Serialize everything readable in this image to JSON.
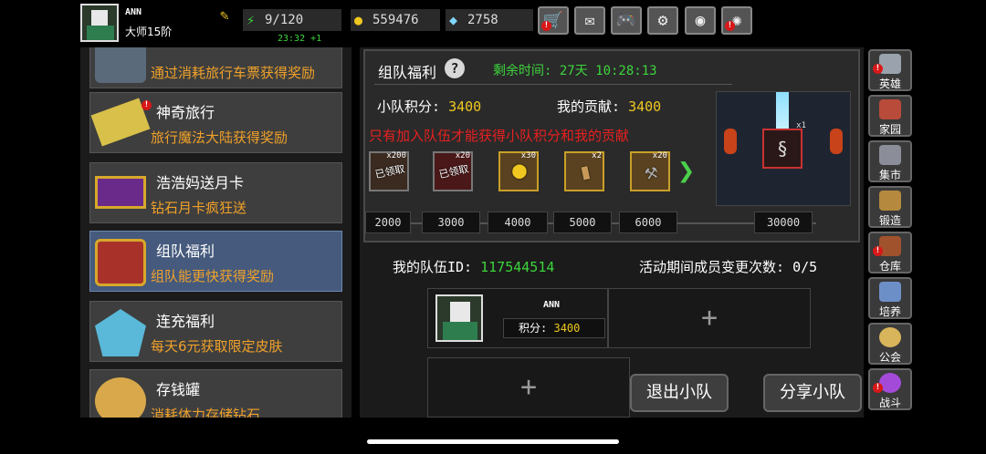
{
  "player": {
    "name": "ANN",
    "rank": "大师15阶"
  },
  "stats": {
    "energy": "9/120",
    "energy_timer": "23:32 +1",
    "gold": "559476",
    "gems": "2758"
  },
  "top_buttons": [
    {
      "name": "shop-cart-button",
      "glyph": "🛒",
      "alert": true
    },
    {
      "name": "mail-button",
      "glyph": "✉",
      "alert": false
    },
    {
      "name": "gamepad-button",
      "glyph": "🎮",
      "alert": false
    },
    {
      "name": "settings-button",
      "glyph": "⚙",
      "alert": false
    },
    {
      "name": "wheel-button",
      "glyph": "◉",
      "alert": false
    },
    {
      "name": "firework-button",
      "glyph": "✺",
      "alert": true
    }
  ],
  "events": [
    {
      "title": "",
      "desc": "通过消耗旅行车票获得奖励",
      "icon": "cart-icon"
    },
    {
      "title": "神奇旅行",
      "desc": "旅行魔法大陆获得奖励",
      "icon": "ticket-icon"
    },
    {
      "title": "浩浩妈送月卡",
      "desc": "钻石月卡疯狂送",
      "icon": "card-icon"
    },
    {
      "title": "组队福利",
      "desc": "组队能更快获得奖励",
      "icon": "chest-icon"
    },
    {
      "title": "连充福利",
      "desc": "每天6元获取限定皮肤",
      "icon": "crystal-icon"
    },
    {
      "title": "存钱罐",
      "desc": "消耗体力存储钻石",
      "icon": "piggy-bank-icon"
    }
  ],
  "panel": {
    "title": "组队福利",
    "remaining": "剩余时间: 27天 10:28:13",
    "team_score_label": "小队积分:",
    "team_score": "3400",
    "my_contrib_label": "我的贡献:",
    "my_contrib": "3400",
    "warning": "只有加入队伍才能获得小队积分和我的贡献",
    "rewards": [
      {
        "qty": "x200",
        "claimed": "已领取",
        "icon": "scroll-icon"
      },
      {
        "qty": "x20",
        "claimed": "已领取",
        "icon": "bag-icon"
      },
      {
        "qty": "x30",
        "claimed": "",
        "icon": "golden-egg-icon"
      },
      {
        "qty": "x2",
        "claimed": "",
        "icon": "bottle-icon"
      },
      {
        "qty": "x20",
        "claimed": "",
        "icon": "hammer-icon"
      }
    ],
    "milestones": [
      "2000",
      "3000",
      "4000",
      "5000",
      "6000",
      "30000"
    ],
    "grand_prize_qty": "x1"
  },
  "team": {
    "id_label": "我的队伍ID:",
    "id": "117544514",
    "changes": "活动期间成员变更次数: 0/5",
    "member_name": "ANN",
    "member_score_label": "积分:",
    "member_score": "3400",
    "leave_label": "退出小队",
    "share_label": "分享小队"
  },
  "side_menu": [
    {
      "label": "英雄",
      "color": "#9aa3ad",
      "alert": true
    },
    {
      "label": "家园",
      "color": "#b94b3a",
      "alert": false
    },
    {
      "label": "集市",
      "color": "#8b8e99",
      "alert": false
    },
    {
      "label": "锻造",
      "color": "#b58a3e",
      "alert": false
    },
    {
      "label": "仓库",
      "color": "#a0522d",
      "alert": true
    },
    {
      "label": "培养",
      "color": "#6d8fc8",
      "alert": false
    },
    {
      "label": "公会",
      "color": "#d8b45a",
      "alert": false
    },
    {
      "label": "战斗",
      "color": "#a34bd8",
      "alert": true
    }
  ]
}
